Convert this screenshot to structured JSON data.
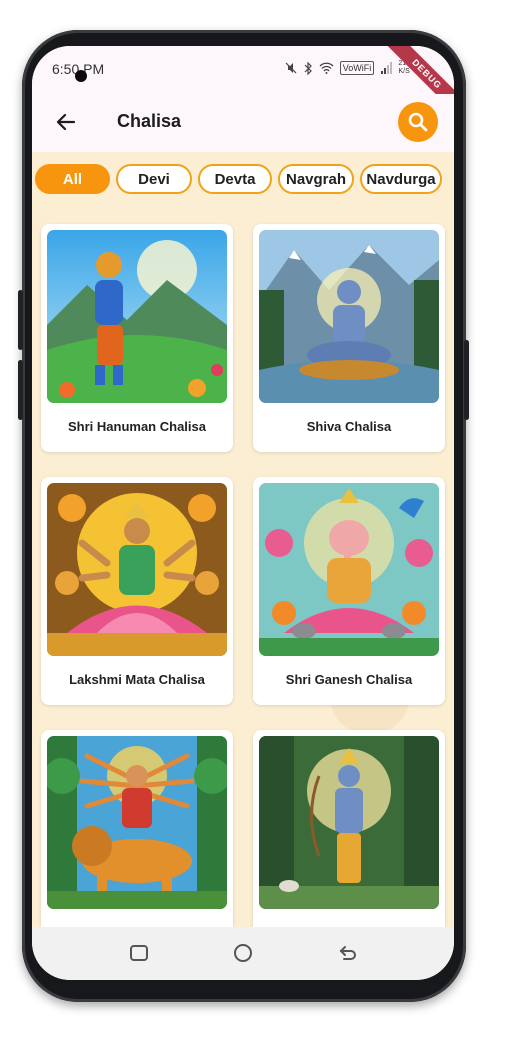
{
  "status_bar": {
    "time": "6:50 PM",
    "vowifi": "VoWiFi",
    "speed_top": "218",
    "speed_bottom": "K/S",
    "debug_banner": "DEBUG"
  },
  "appbar": {
    "title": "Chalisa",
    "back_icon": "arrow-left-icon",
    "search_icon": "search-icon"
  },
  "filters": [
    {
      "label": "All",
      "active": true
    },
    {
      "label": "Devi",
      "active": false
    },
    {
      "label": "Devta",
      "active": false
    },
    {
      "label": "Navgrah",
      "active": false
    },
    {
      "label": "Navdurga",
      "active": false
    }
  ],
  "cards": [
    {
      "label": "Shri Hanuman Chalisa"
    },
    {
      "label": "Shiva Chalisa"
    },
    {
      "label": "Lakshmi Mata Chalisa"
    },
    {
      "label": "Shri Ganesh Chalisa"
    },
    {
      "label": ""
    },
    {
      "label": ""
    }
  ],
  "colors": {
    "accent": "#f7950f",
    "chip_border": "#f0a21a",
    "background": "#fbeed3",
    "appbar": "#fdf6fb"
  },
  "navigation": {
    "recents_icon": "square-icon",
    "home_icon": "circle-icon",
    "back_icon": "back-arrow-icon"
  }
}
